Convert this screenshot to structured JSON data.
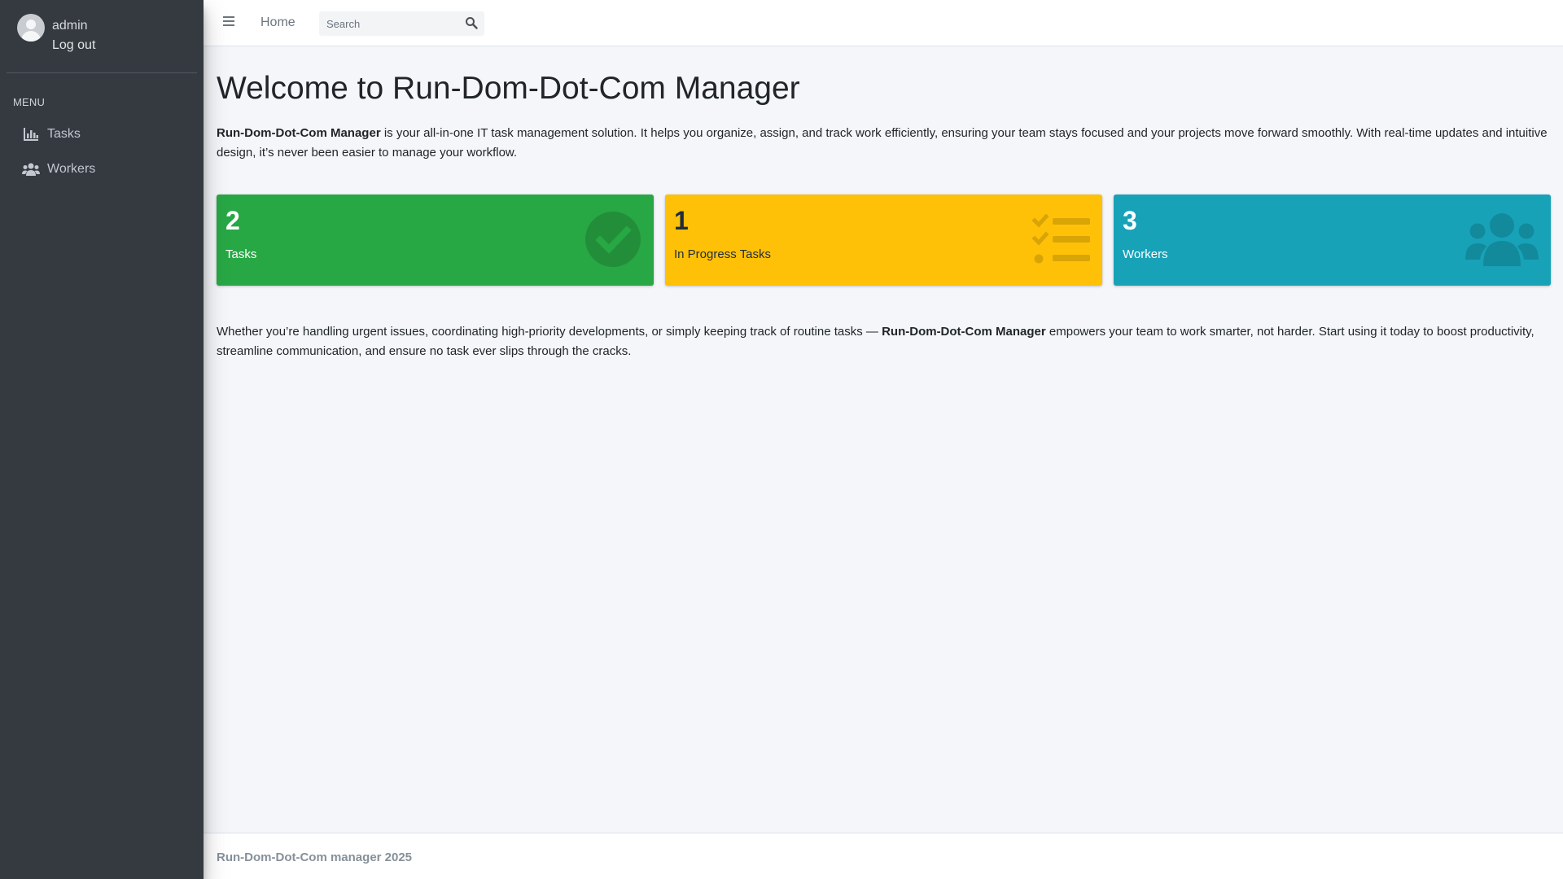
{
  "user": {
    "name": "admin",
    "logout_label": "Log out"
  },
  "sidebar": {
    "menu_header": "MENU",
    "items": [
      {
        "label": "Tasks",
        "icon": "chart-bar-icon"
      },
      {
        "label": "Workers",
        "icon": "users-icon"
      }
    ]
  },
  "navbar": {
    "menu_icon": "hamburger-icon",
    "home_label": "Home",
    "search_placeholder": "Search",
    "search_value": "",
    "search_icon": "search-icon"
  },
  "main": {
    "title": "Welcome to Run-Dom-Dot-Com Manager",
    "intro_brand": "Run-Dom-Dot-Com Manager",
    "intro_text": " is your all-in-one IT task management solution. It helps you organize, assign, and track work efficiently, ensuring your team stays focused and your projects move forward smoothly. With real-time updates and intuitive design, it’s never been easier to manage your workflow.",
    "stats": [
      {
        "count": "2",
        "label": "Tasks",
        "icon": "check-circle-icon",
        "color": "#28a745"
      },
      {
        "count": "1",
        "label": "In Progress Tasks",
        "icon": "tasks-list-icon",
        "color": "#ffc107"
      },
      {
        "count": "3",
        "label": "Workers",
        "icon": "users-icon",
        "color": "#17a2b8"
      }
    ],
    "outro_before": "Whether you’re handling urgent issues, coordinating high-priority developments, or simply keeping track of routine tasks — ",
    "outro_brand": "Run-Dom-Dot-Com Manager",
    "outro_after": " empowers your team to work smarter, not harder. Start using it today to boost productivity, streamline communication, and ensure no task ever slips through the cracks."
  },
  "footer": {
    "text": "Run-Dom-Dot-Com manager 2025"
  }
}
